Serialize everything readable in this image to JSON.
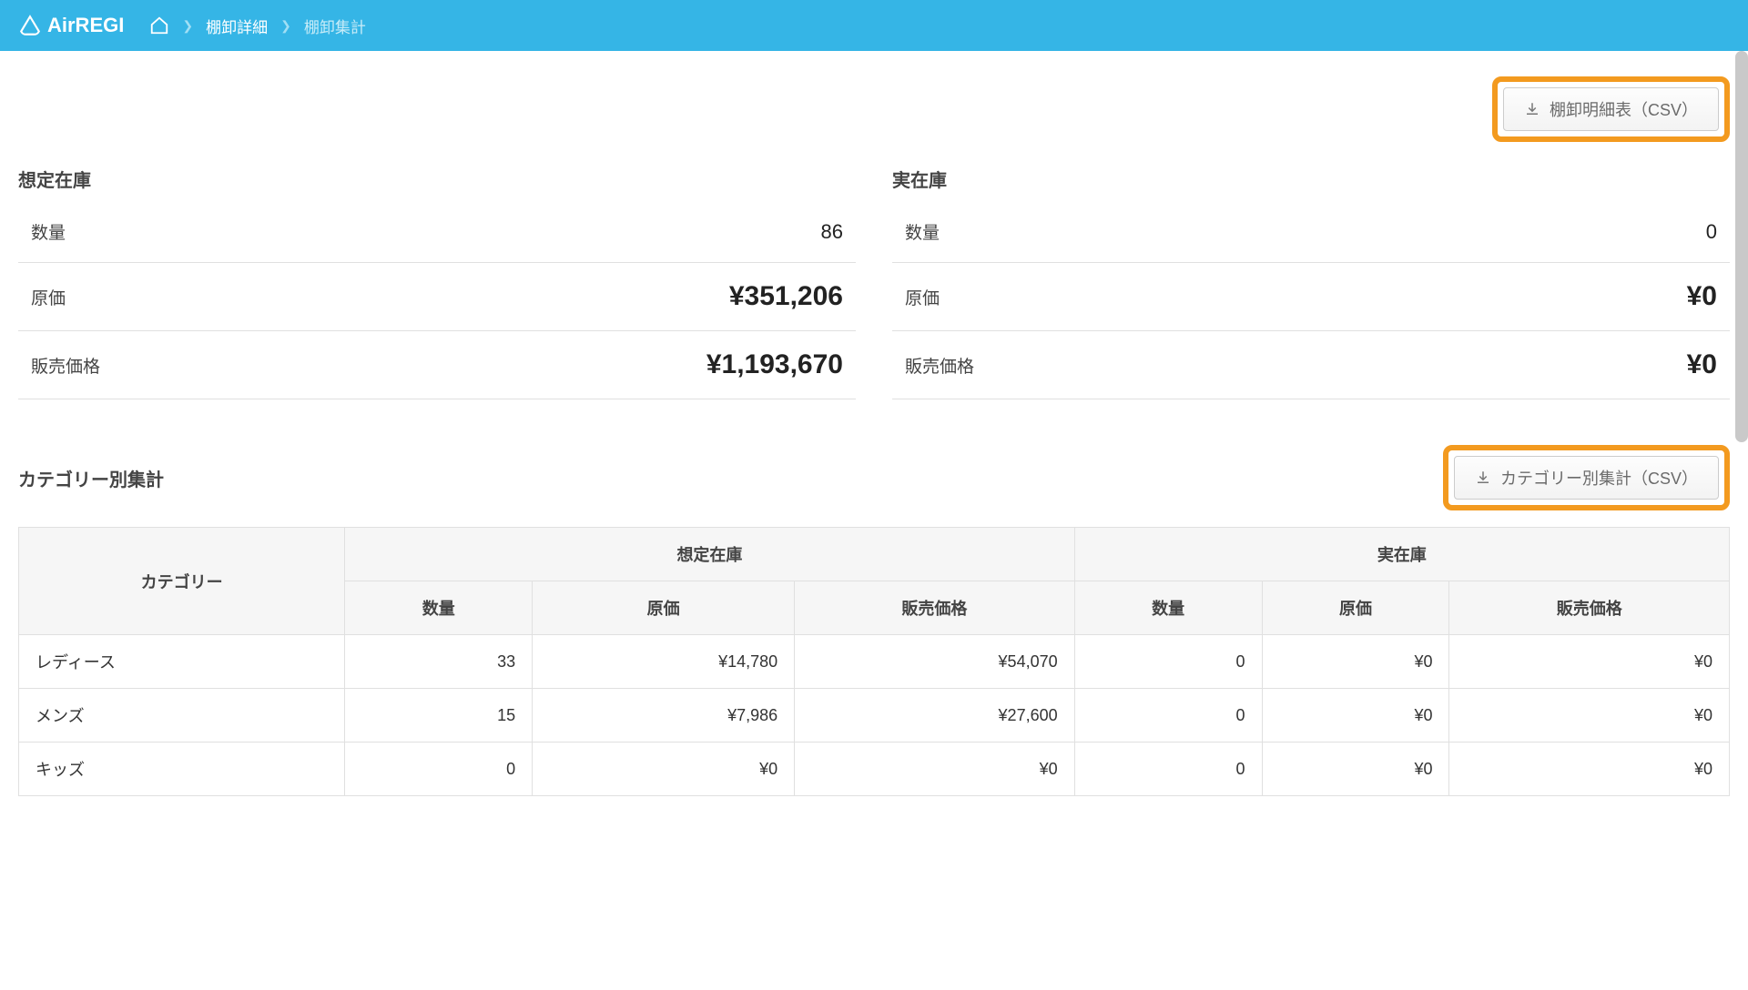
{
  "app": {
    "name": "AirREGI"
  },
  "breadcrumb": {
    "prev": "棚卸詳細",
    "current": "棚卸集計"
  },
  "buttons": {
    "csv_detail": "棚卸明細表（CSV）",
    "csv_category": "カテゴリー別集計（CSV）"
  },
  "summary": {
    "estimated": {
      "title": "想定在庫",
      "qty_label": "数量",
      "qty": "86",
      "cost_label": "原価",
      "cost": "¥351,206",
      "price_label": "販売価格",
      "price": "¥1,193,670"
    },
    "actual": {
      "title": "実在庫",
      "qty_label": "数量",
      "qty": "0",
      "cost_label": "原価",
      "cost": "¥0",
      "price_label": "販売価格",
      "price": "¥0"
    }
  },
  "category_section": {
    "title": "カテゴリー別集計",
    "headers": {
      "category": "カテゴリー",
      "estimated": "想定在庫",
      "actual": "実在庫",
      "qty": "数量",
      "cost": "原価",
      "price": "販売価格"
    },
    "rows": [
      {
        "name": "レディース",
        "est_qty": "33",
        "est_cost": "¥14,780",
        "est_price": "¥54,070",
        "act_qty": "0",
        "act_cost": "¥0",
        "act_price": "¥0"
      },
      {
        "name": "メンズ",
        "est_qty": "15",
        "est_cost": "¥7,986",
        "est_price": "¥27,600",
        "act_qty": "0",
        "act_cost": "¥0",
        "act_price": "¥0"
      },
      {
        "name": "キッズ",
        "est_qty": "0",
        "est_cost": "¥0",
        "est_price": "¥0",
        "act_qty": "0",
        "act_cost": "¥0",
        "act_price": "¥0"
      }
    ]
  }
}
